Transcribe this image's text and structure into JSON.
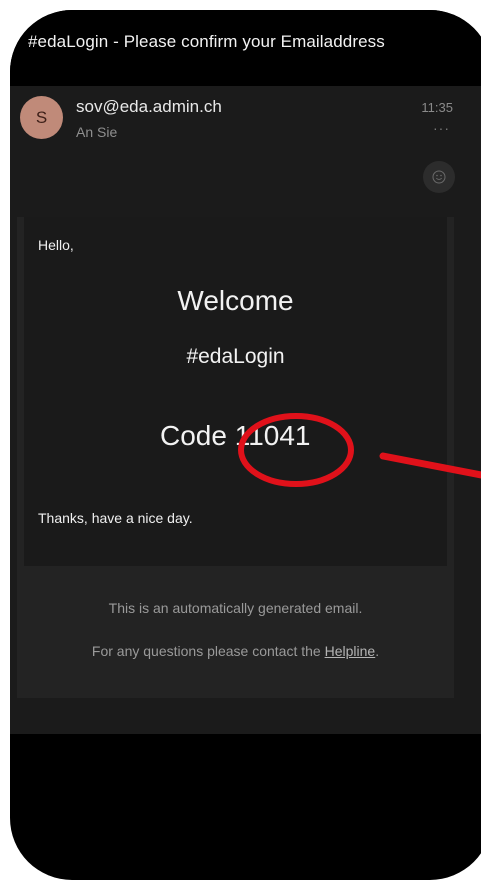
{
  "email": {
    "subject": "#edaLogin - Please confirm your Emailaddress",
    "sender": "sov@eda.admin.ch",
    "avatar_initial": "S",
    "recipient": "An Sie",
    "time": "11:35",
    "more_glyph": "···",
    "body": {
      "greeting": "Hello,",
      "welcome": "Welcome",
      "product": "#edaLogin",
      "code_label": "Code",
      "code_value": "11041",
      "closing": "Thanks, have a nice day."
    },
    "footer": {
      "auto_note": "This is an automatically generated email.",
      "contact_prefix": "For any questions please contact the ",
      "helpline_link": "Helpline",
      "contact_suffix": "."
    }
  },
  "annotation": {
    "color": "#e0111a",
    "type": "circle-and-arrow"
  },
  "icons": {
    "avatar": "avatar-icon",
    "more": "more-options-icon",
    "emoji": "emoji-reaction-icon"
  }
}
